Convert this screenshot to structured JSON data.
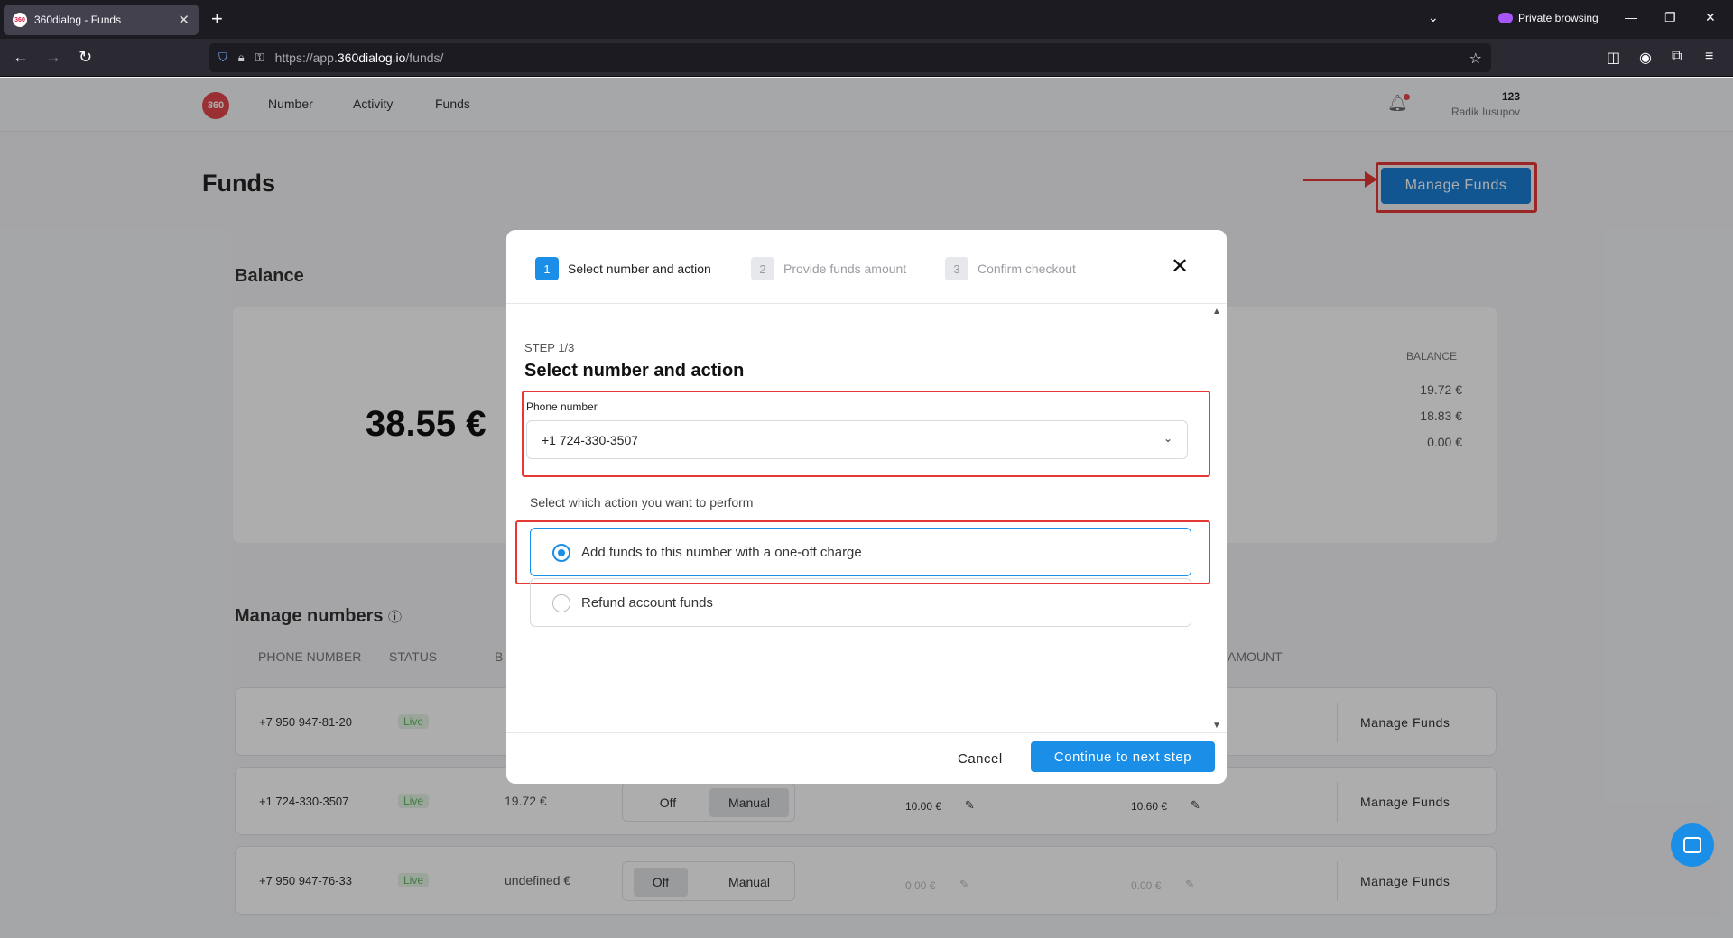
{
  "browser": {
    "tab_title": "360dialog - Funds",
    "tab_favicon": "360",
    "private_label": "Private browsing",
    "url_prefix": "https://app.",
    "url_domain": "360dialog.io",
    "url_path": "/funds/"
  },
  "app": {
    "logo_text": "360",
    "nav": [
      "Number",
      "Activity",
      "Funds"
    ],
    "user_number": "123",
    "user_name": "Radik Iusupov",
    "page_title": "Funds",
    "manage_funds_label": "Manage Funds",
    "balance_title": "Balance",
    "total_balance": "38.55 €",
    "balance_col_header": "BALANCE",
    "balance_values": [
      "19.72 €",
      "18.83 €",
      "0.00 €"
    ],
    "manage_numbers_title": "Manage numbers",
    "columns": [
      "PHONE NUMBER",
      "STATUS",
      "B",
      "AMOUNT"
    ],
    "rows": [
      {
        "phone": "+7 950 947-81-20",
        "status": "Live",
        "balance": "",
        "off": "",
        "manual": "",
        "amt1": "",
        "amt2": "",
        "action": "Manage Funds"
      },
      {
        "phone": "+1 724-330-3507",
        "status": "Live",
        "balance": "19.72 €",
        "off": "Off",
        "manual": "Manual",
        "amt1": "10.00 €",
        "amt2": "10.60 €",
        "action": "Manage Funds"
      },
      {
        "phone": "+7 950 947-76-33",
        "status": "Live",
        "balance": "undefined €",
        "off": "Off",
        "manual": "Manual",
        "amt1": "0.00 €",
        "amt2": "0.00 €",
        "action": "Manage Funds"
      }
    ]
  },
  "modal": {
    "steps": [
      {
        "num": "1",
        "label": "Select number and action"
      },
      {
        "num": "2",
        "label": "Provide funds amount"
      },
      {
        "num": "3",
        "label": "Confirm checkout"
      }
    ],
    "step_indicator": "STEP 1/3",
    "title": "Select number and action",
    "phone_label": "Phone number",
    "phone_value": "+1 724-330-3507",
    "action_prompt": "Select which action you want to perform",
    "options": [
      "Add funds to this number with a one-off charge",
      "Refund account funds"
    ],
    "cancel_label": "Cancel",
    "continue_label": "Continue to next step"
  },
  "colors": {
    "accent": "#1b8fe8",
    "highlight": "#e53935",
    "live": "#5cb85c"
  }
}
